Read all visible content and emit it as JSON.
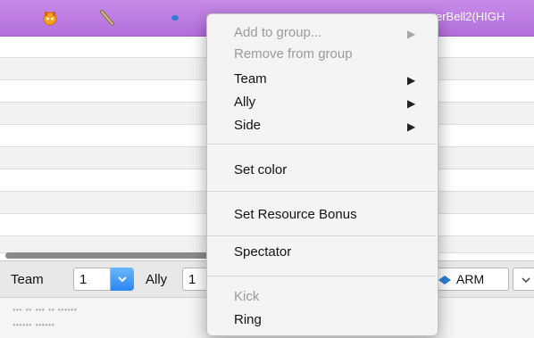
{
  "header": {
    "player_name_partial": "erBell2(HIGH"
  },
  "controls": {
    "team_label": "Team",
    "team_value": "1",
    "ally_label": "Ally",
    "ally_value": "1",
    "side_value": "ARM"
  },
  "chat": {
    "lines": [
      "... .. ... .. ......",
      "...... ......"
    ]
  },
  "context_menu": {
    "items": [
      {
        "label": "Add to group...",
        "enabled": false,
        "submenu": true
      },
      {
        "label": "Remove from group",
        "enabled": false,
        "submenu": false
      },
      {
        "label": "Team",
        "enabled": true,
        "submenu": true
      },
      {
        "label": "Ally",
        "enabled": true,
        "submenu": true
      },
      {
        "label": "Side",
        "enabled": true,
        "submenu": true
      },
      {
        "label": "Set color",
        "enabled": true,
        "submenu": false
      },
      {
        "label": "Set Resource Bonus",
        "enabled": true,
        "submenu": false
      },
      {
        "label": "Spectator",
        "enabled": true,
        "submenu": false
      },
      {
        "label": "Kick",
        "enabled": false,
        "submenu": false
      },
      {
        "label": "Ring",
        "enabled": true,
        "submenu": false
      }
    ],
    "submenu_arrow": "▶"
  },
  "colors": {
    "header": "#b97ae0",
    "accent": "#2b86f0"
  },
  "icons": [
    "status-icon",
    "rank-icon",
    "faction-icon",
    "arm-faction-icon",
    "chevron-down-icon",
    "submenu-arrow-icon"
  ]
}
